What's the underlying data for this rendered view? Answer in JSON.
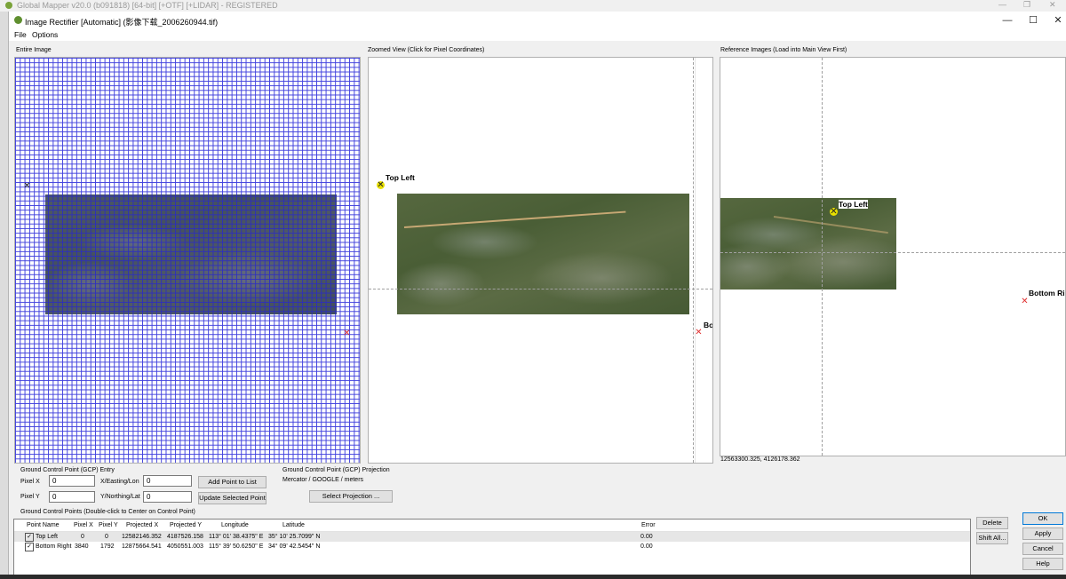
{
  "background_window": {
    "title": "Global Mapper v20.0 (b091818) [64-bit] [+OTF] [+LIDAR] - REGISTERED"
  },
  "dialog": {
    "title": "Image Rectifier [Automatic] (影像下载_2006260944.tif)",
    "controls": {
      "minimize": "—",
      "maximize": "☐",
      "close": "✕"
    }
  },
  "menu": {
    "items": [
      "File",
      "Options"
    ]
  },
  "panels": {
    "entire_image": {
      "label": "Entire Image"
    },
    "zoomed_view": {
      "label": "Zoomed View (Click for Pixel Coordinates)",
      "top_left": "Top Left",
      "bottom_right_partial": "Bo"
    },
    "reference": {
      "label": "Reference Images (Load into Main View First)",
      "top_left": "Top Left",
      "bottom_right_partial": "Bottom Ri",
      "coords": "12563300.325, 4126178.362"
    }
  },
  "gcp_entry": {
    "label": "Ground Control Point (GCP) Entry",
    "pixel_x_label": "Pixel X",
    "pixel_x_value": "0",
    "pixel_y_label": "Pixel Y",
    "pixel_y_value": "0",
    "easting_label": "X/Easting/Lon",
    "easting_value": "0",
    "northing_label": "Y/Northing/Lat",
    "northing_value": "0",
    "add_button": "Add Point to List",
    "update_button": "Update Selected Point"
  },
  "gcp_projection": {
    "label": "Ground Control Point (GCP) Projection",
    "value": "Mercator / GOOGLE / meters",
    "select_button": "Select Projection ..."
  },
  "gcp_list": {
    "label": "Ground Control Points (Double-click to Center on Control Point)",
    "columns": [
      "Point Name",
      "Pixel X",
      "Pixel Y",
      "Projected X",
      "Projected Y",
      "Longitude",
      "Latitude",
      "Error"
    ],
    "rows": [
      {
        "name": "Top Left",
        "px": "0",
        "py": "0",
        "proj_x": "12582146.352",
        "proj_y": "4187526.158",
        "lon": "113° 01' 38.4375\" E",
        "lat": "35° 10' 25.7099\" N",
        "error": "0.00"
      },
      {
        "name": "Bottom Right",
        "px": "3840",
        "py": "1792",
        "proj_x": "12875664.541",
        "proj_y": "4050551.003",
        "lon": "115° 39' 50.6250\" E",
        "lat": "34° 09' 42.5454\" N",
        "error": "0.00"
      }
    ]
  },
  "side_buttons": {
    "delete": "Delete",
    "shift_all": "Shift All..."
  },
  "dialog_buttons": {
    "ok": "OK",
    "apply": "Apply",
    "cancel": "Cancel",
    "help": "Help"
  },
  "colors": {
    "grid": "#2020d8",
    "marker_red": "#e03030",
    "marker_yellow": "#f0e000",
    "ok_border": "#0078d7"
  }
}
